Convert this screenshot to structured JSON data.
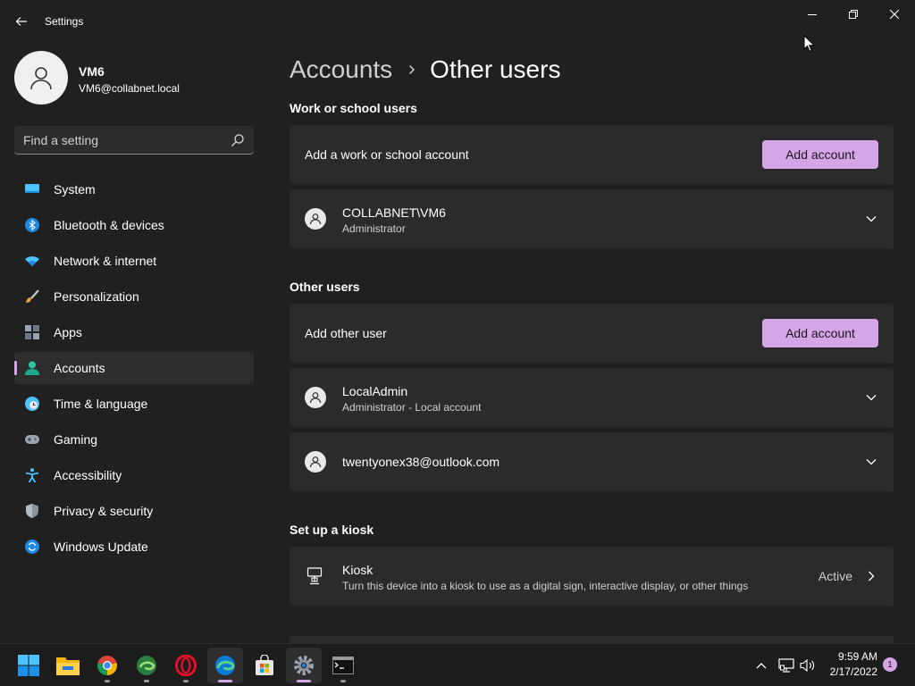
{
  "window": {
    "title": "Settings"
  },
  "profile": {
    "name": "VM6",
    "email": "VM6@collabnet.local"
  },
  "search": {
    "placeholder": "Find a setting"
  },
  "nav": {
    "items": [
      {
        "label": "System",
        "icon": "monitor-icon",
        "selected": false
      },
      {
        "label": "Bluetooth & devices",
        "icon": "bluetooth-icon",
        "selected": false
      },
      {
        "label": "Network & internet",
        "icon": "wifi-icon",
        "selected": false
      },
      {
        "label": "Personalization",
        "icon": "brush-icon",
        "selected": false
      },
      {
        "label": "Apps",
        "icon": "apps-icon",
        "selected": false
      },
      {
        "label": "Accounts",
        "icon": "person-icon",
        "selected": true
      },
      {
        "label": "Time & language",
        "icon": "clock-globe-icon",
        "selected": false
      },
      {
        "label": "Gaming",
        "icon": "gamepad-icon",
        "selected": false
      },
      {
        "label": "Accessibility",
        "icon": "accessibility-icon",
        "selected": false
      },
      {
        "label": "Privacy & security",
        "icon": "shield-icon",
        "selected": false
      },
      {
        "label": "Windows Update",
        "icon": "update-icon",
        "selected": false
      }
    ]
  },
  "breadcrumb": {
    "parent": "Accounts",
    "current": "Other users"
  },
  "work_section": {
    "title": "Work or school users",
    "add_label": "Add a work or school account",
    "add_button": "Add account",
    "users": [
      {
        "name": "COLLABNET\\VM6",
        "detail": "Administrator"
      }
    ]
  },
  "other_section": {
    "title": "Other users",
    "add_label": "Add other user",
    "add_button": "Add account",
    "users": [
      {
        "name": "LocalAdmin",
        "detail": "Administrator - Local account"
      },
      {
        "name": "twentyonex38@outlook.com",
        "detail": ""
      }
    ]
  },
  "kiosk_section": {
    "title": "Set up a kiosk",
    "name": "Kiosk",
    "description": "Turn this device into a kiosk to use as a digital sign, interactive display, or other things",
    "status": "Active"
  },
  "taskbar": {
    "apps": [
      "start-icon",
      "file-explorer-icon",
      "chrome-icon",
      "edge-dev-icon",
      "opera-icon",
      "edge-icon",
      "store-icon",
      "settings-icon",
      "terminal-icon"
    ],
    "clock_time": "9:59 AM",
    "clock_date": "2/17/2022",
    "notification_count": "1"
  },
  "colors": {
    "accent": "#d6a5e8",
    "background": "#202020",
    "card": "#2b2b2b"
  }
}
